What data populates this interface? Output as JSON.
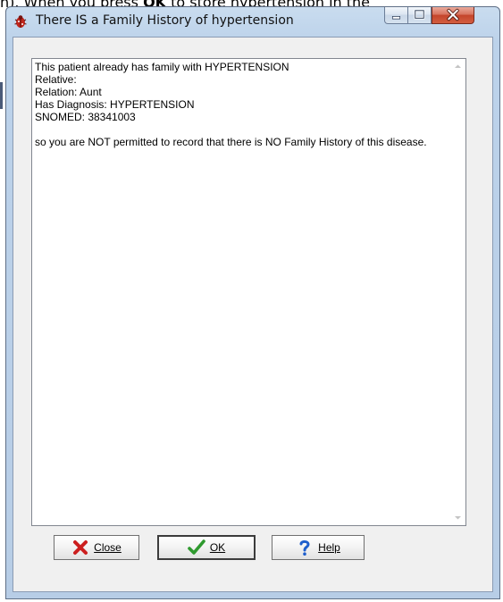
{
  "background_caption": {
    "before": "n). When you press ",
    "bold": "OK",
    "after": " to store hypertension in the"
  },
  "window": {
    "title": "There IS a Family History of hypertension",
    "controls": {
      "minimize": "minimize-icon",
      "maximize": "maximize-icon",
      "close": "close-icon"
    }
  },
  "message": {
    "lines": [
      "This patient already has family with HYPERTENSION",
      "Relative:",
      "Relation: Aunt",
      "Has Diagnosis: HYPERTENSION",
      "SNOMED: 38341003",
      "",
      "so you are NOT permitted to record that there is NO Family History of this disease."
    ]
  },
  "buttons": {
    "close_label": "Close",
    "ok_label": "OK",
    "help_label": "Help"
  },
  "colors": {
    "close_x": "#cc1f1f",
    "ok_check": "#2f9a2f",
    "help_question": "#1f5fcc",
    "title_close": "#c4452c"
  }
}
